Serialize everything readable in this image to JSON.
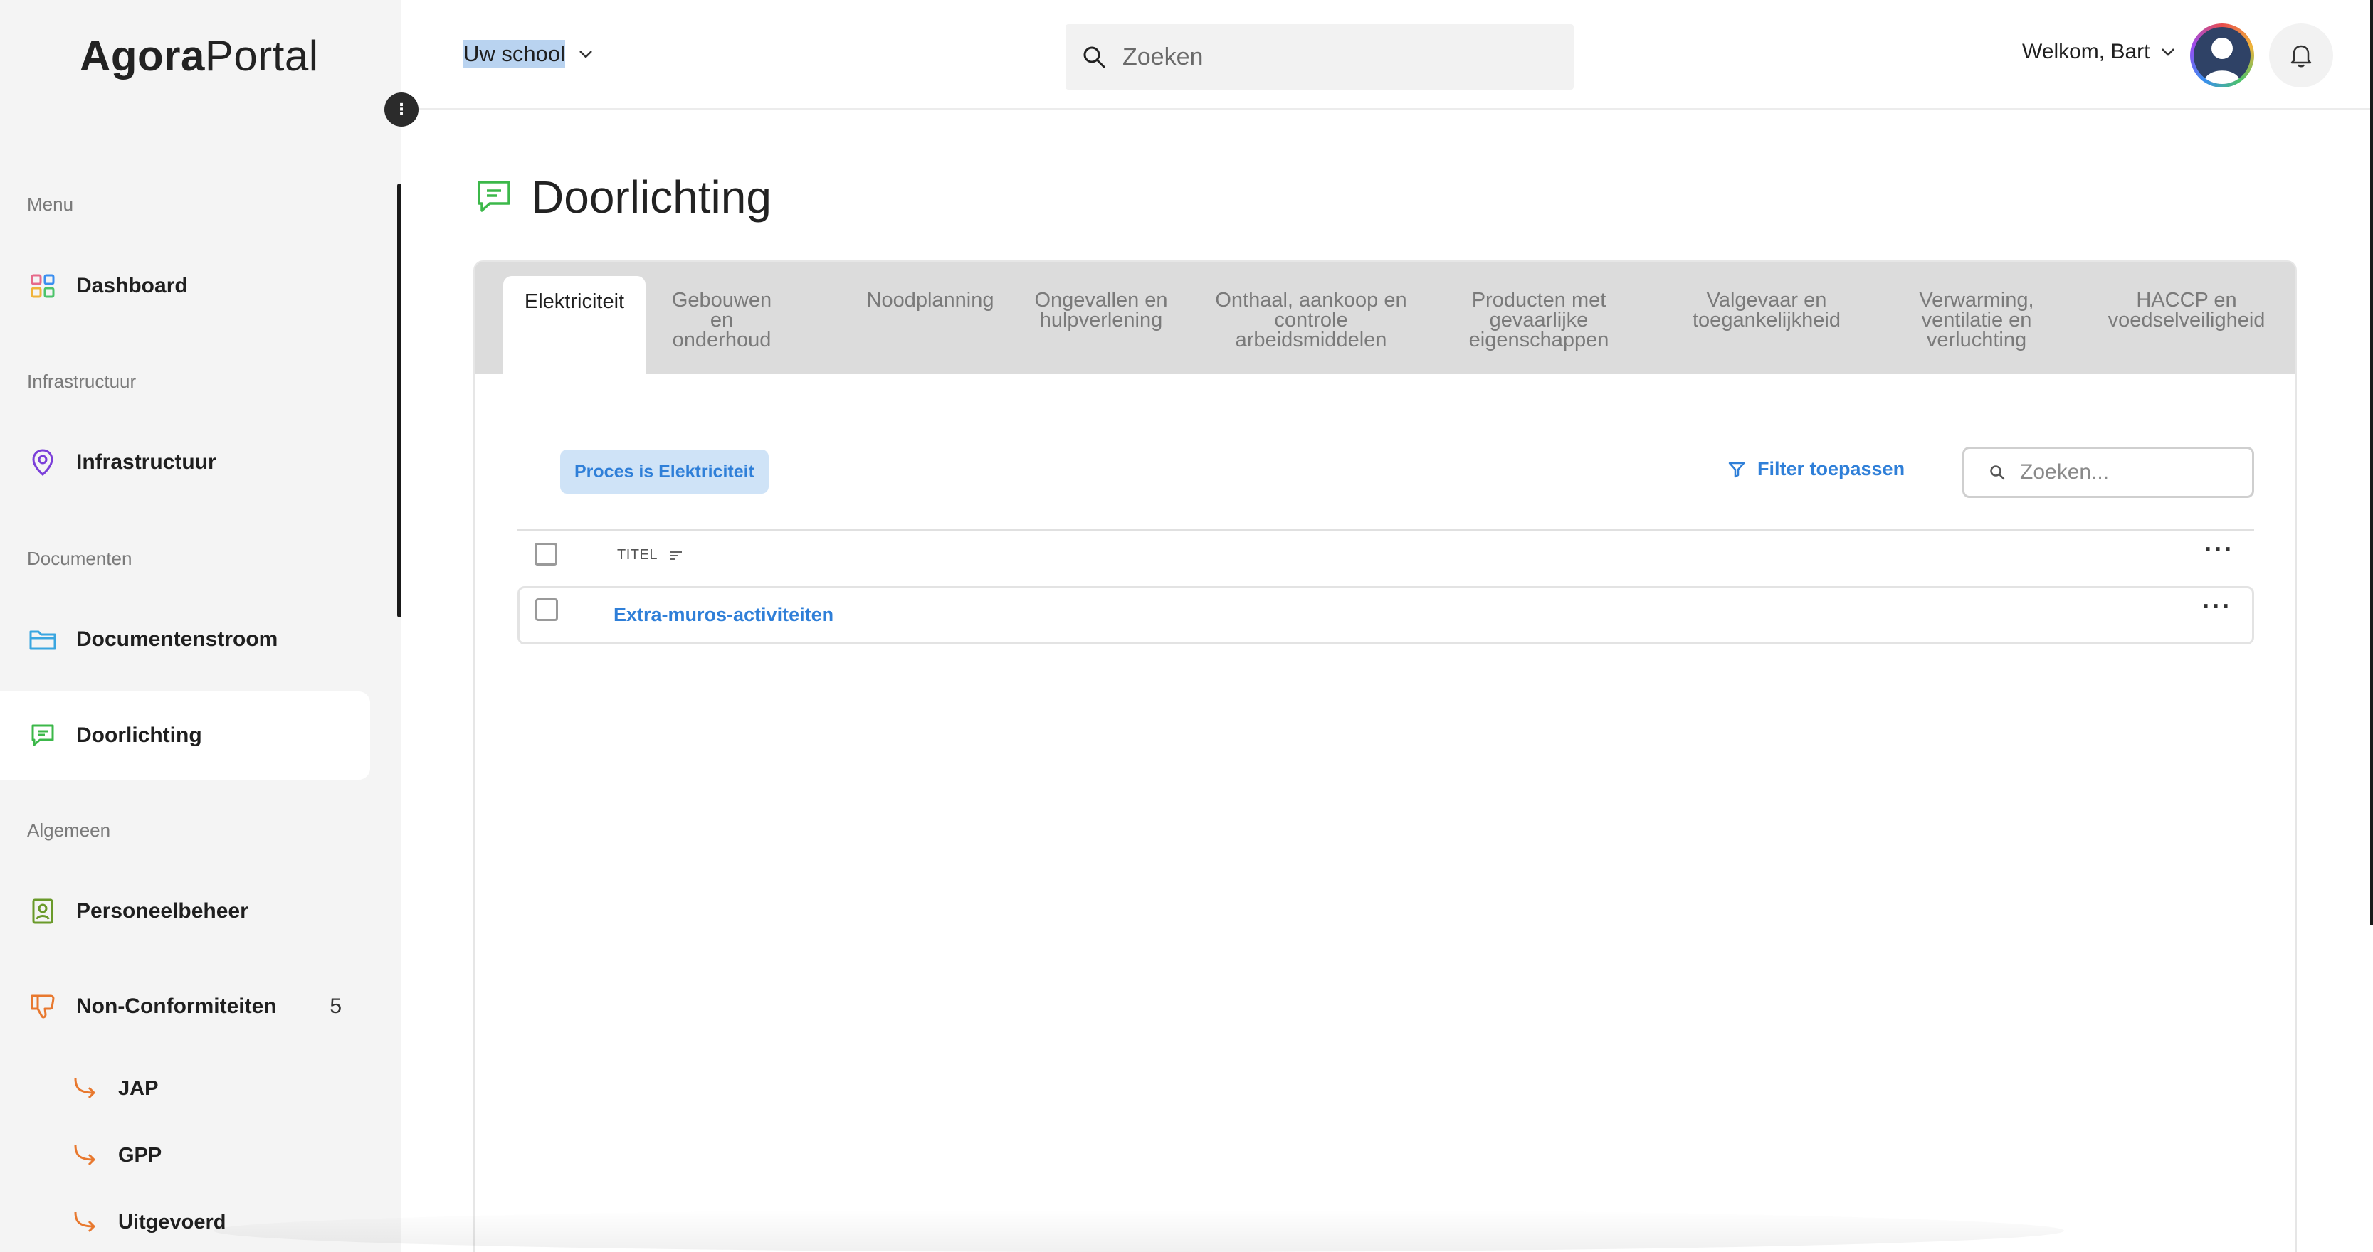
{
  "app": {
    "logo_bold": "Agora",
    "logo_regular": "Portal"
  },
  "header": {
    "school_label": "Uw school",
    "search_placeholder": "Zoeken",
    "welcome": "Welkom, Bart"
  },
  "sidebar": {
    "sections": {
      "menu": "Menu",
      "infrastructuur": "Infrastructuur",
      "documenten": "Documenten",
      "algemeen": "Algemeen"
    },
    "items": {
      "dashboard": "Dashboard",
      "infrastructuur": "Infrastructuur",
      "documentenstroom": "Documentenstroom",
      "doorlichting": "Doorlichting",
      "personeelbeheer": "Personeelbeheer",
      "non_conformiteiten": "Non-Conformiteiten",
      "non_conformiteiten_count": "5"
    },
    "sub_items": [
      "JAP",
      "GPP",
      "Uitgevoerd"
    ],
    "active": "Doorlichting"
  },
  "page": {
    "title": "Doorlichting"
  },
  "tabs": [
    {
      "label": "Elektriciteit",
      "active": true
    },
    {
      "label": "Gebouwen en onderhoud",
      "active": false
    },
    {
      "label": "Noodplanning",
      "active": false
    },
    {
      "label": "Ongevallen en hulpverlening",
      "active": false
    },
    {
      "label": "Onthaal, aankoop en controle arbeidsmiddelen",
      "active": false
    },
    {
      "label": "Producten met gevaarlijke eigenschappen",
      "active": false
    },
    {
      "label": "Valgevaar en toegankelijkheid",
      "active": false
    },
    {
      "label": "Verwarming, ventilatie en verluchting",
      "active": false
    },
    {
      "label": "HACCP en voedselveiligheid",
      "active": false
    }
  ],
  "filters": {
    "chip": "Proces is Elektriciteit",
    "apply_label": "Filter toepassen",
    "search_placeholder": "Zoeken..."
  },
  "table": {
    "columns": [
      "TITEL"
    ],
    "rows": [
      {
        "title": "Extra-muros-activiteiten"
      }
    ]
  },
  "colors": {
    "accent_blue": "#2f7fd8",
    "chip_bg": "#cfe3f7",
    "sidebar_bg": "#f4f4f4",
    "doorlichting_icon": "#3cb84a",
    "non_conf_icon": "#e8782e"
  }
}
